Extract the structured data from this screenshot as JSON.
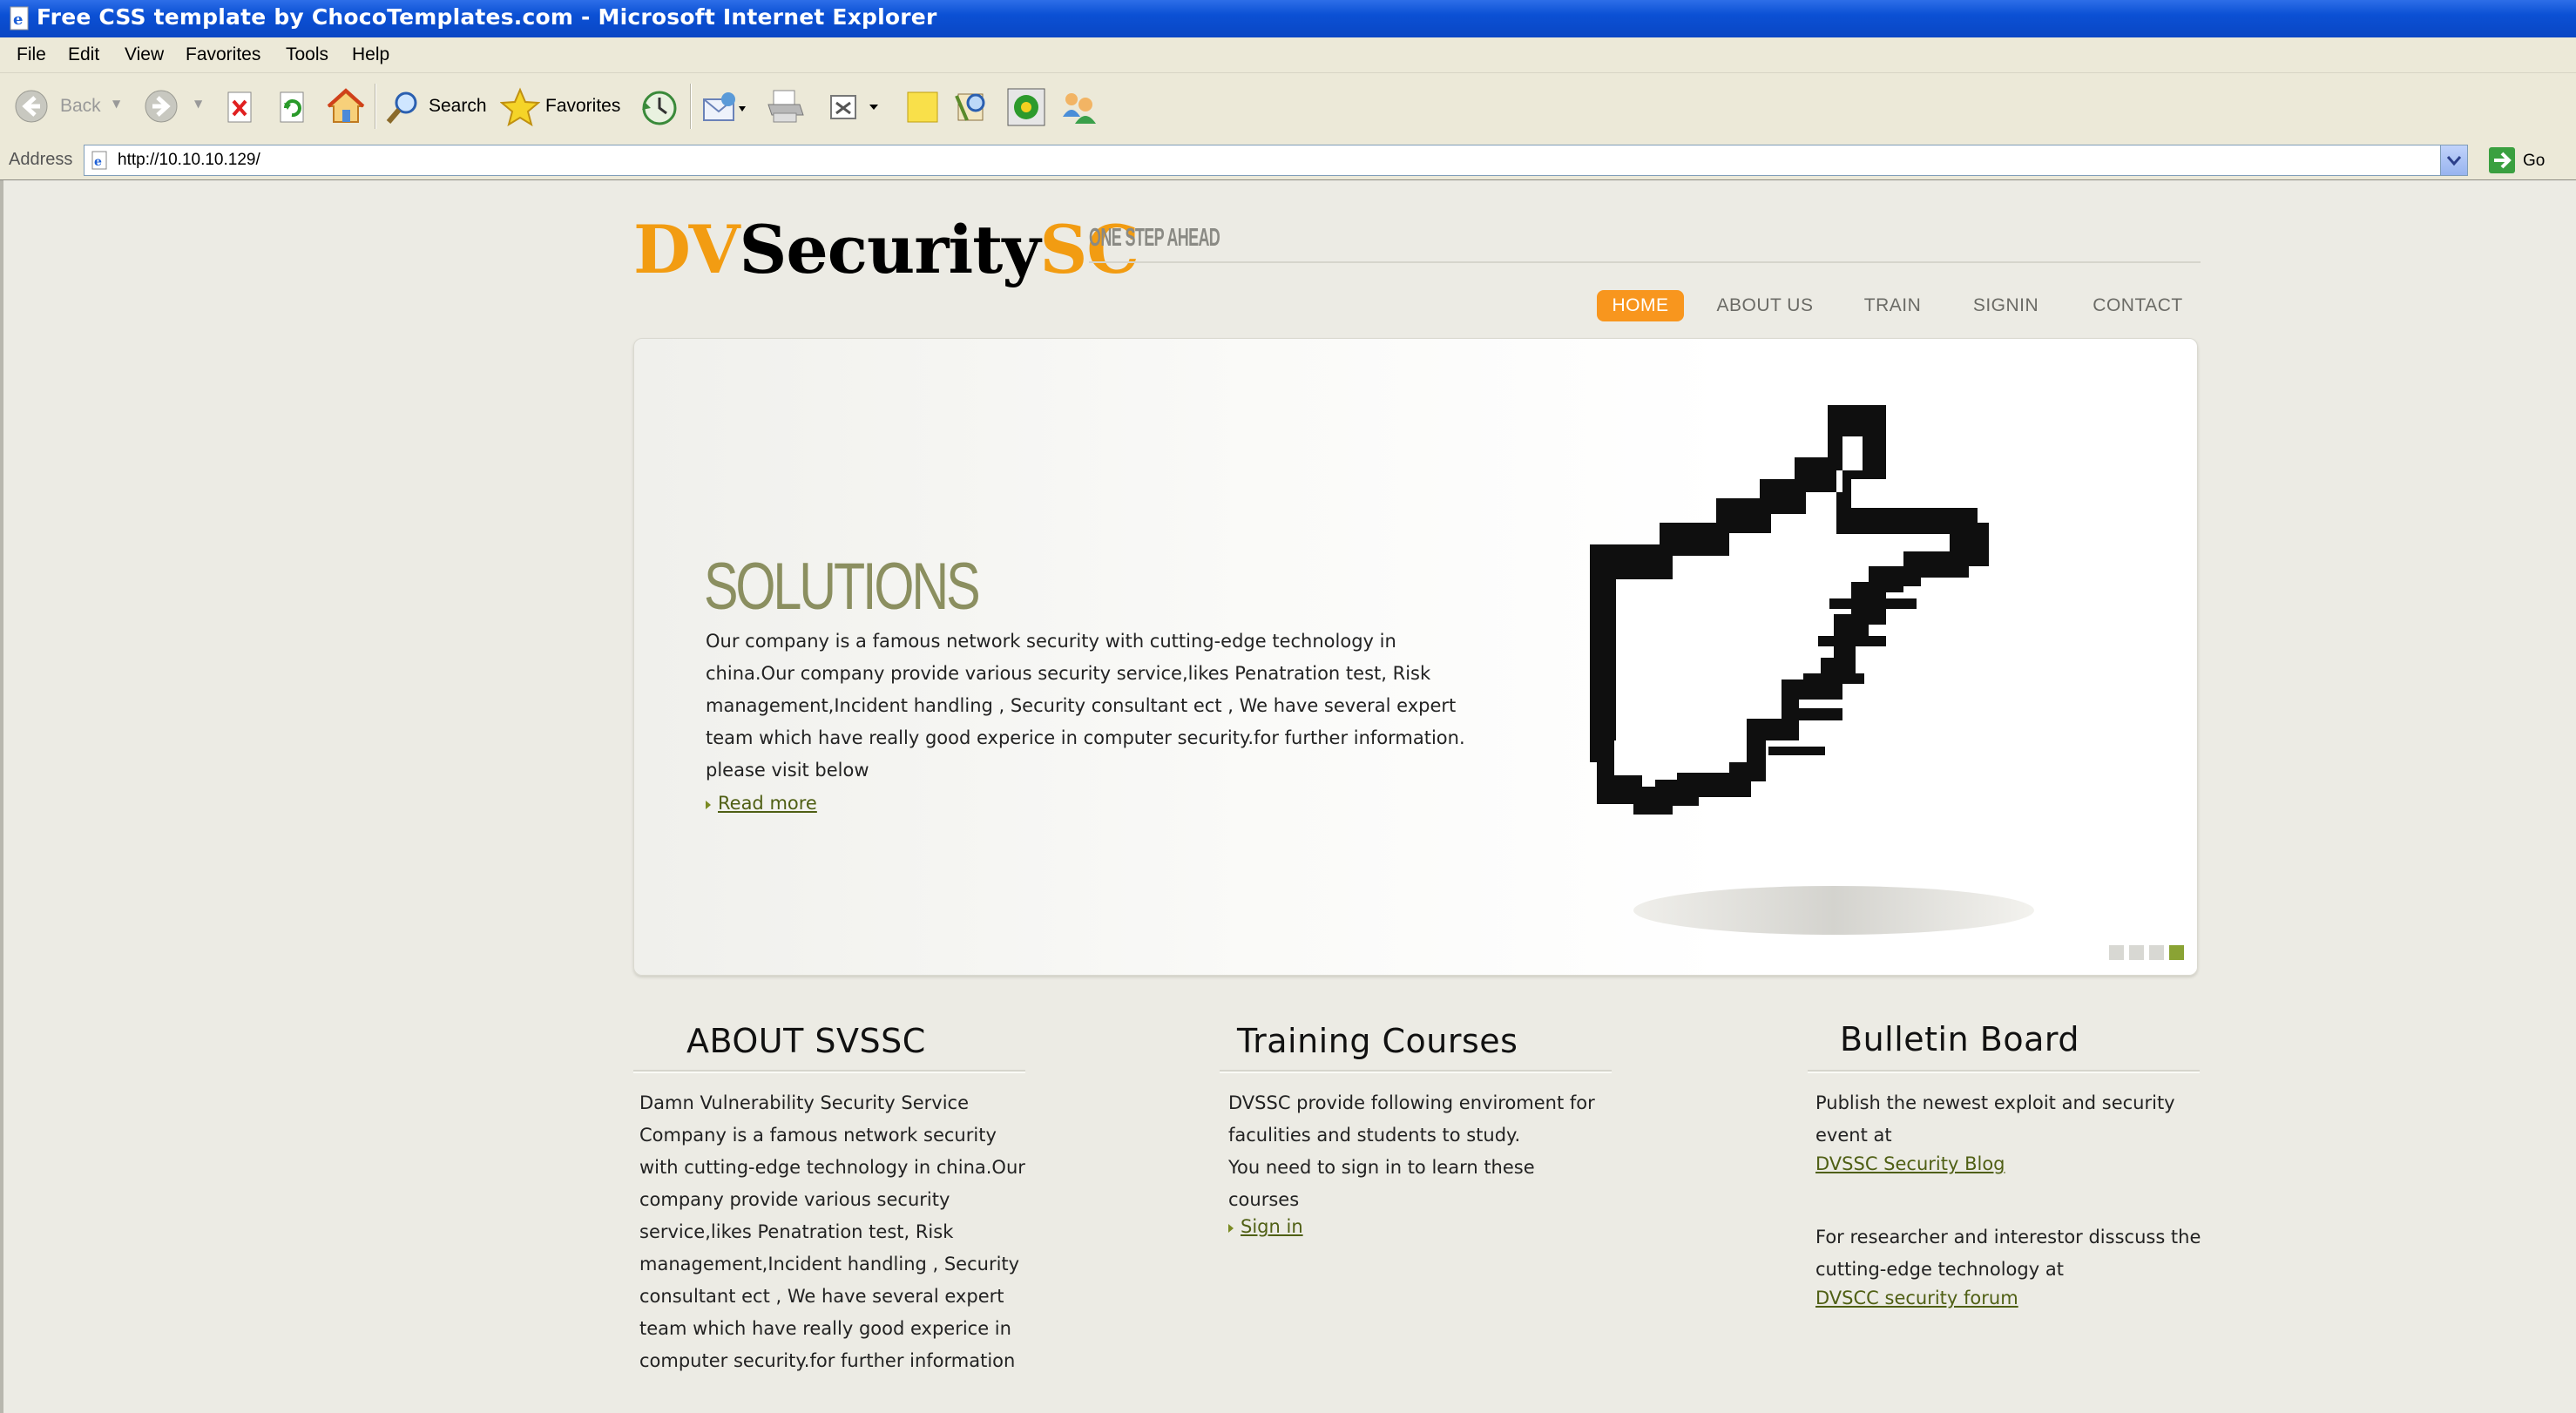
{
  "window": {
    "title": "Free CSS template by ChocoTemplates.com - Microsoft Internet Explorer"
  },
  "menubar": {
    "items": [
      "File",
      "Edit",
      "View",
      "Favorites",
      "Tools",
      "Help"
    ]
  },
  "toolbar": {
    "back_label": "Back",
    "search_label": "Search",
    "favorites_label": "Favorites"
  },
  "address": {
    "label": "Address",
    "url": "http://10.10.10.129/",
    "go_label": "Go"
  },
  "site": {
    "logo": {
      "part1": "DV",
      "part2": "Security",
      "part3": "SC"
    },
    "slogan": "ONE STEP AHEAD",
    "nav": [
      "HOME",
      "ABOUT US",
      "TRAIN",
      "SIGNIN",
      "CONTACT"
    ],
    "nav_active": "HOME",
    "banner": {
      "title": "SOLUTIONS",
      "text": "Our company is a famous network security with cutting-edge technology in china.Our company provide various security service,likes Penatration test, Risk management,Incident handling , Security consultant ect , We have several expert team which have really good experice in computer security.for further information. please visit below",
      "link": "Read more",
      "slide_count": 4,
      "active_slide": 4
    },
    "about": {
      "title": "ABOUT  SVSSC",
      "text": "Damn Vulnerability Security Service Company is a famous network security with cutting-edge technology in china.Our company provide various security service,likes Penatration test, Risk management,Incident handling , Security consultant ect , We have several expert team which have really good experice in computer security.for further information"
    },
    "training": {
      "title": "Training Courses",
      "line1": "DVSSC provide following enviroment for faculities and students to study.",
      "line2": "You need to sign in to learn these courses",
      "link": "Sign in"
    },
    "bulletin": {
      "title": "Bulletin  Board",
      "text1": "Publish the newest exploit and security event at",
      "link1": "DVSSC Security Blog",
      "text2": "For researcher and interestor disscuss the cutting-edge technology at",
      "link2": "DVSCC security forum"
    }
  }
}
